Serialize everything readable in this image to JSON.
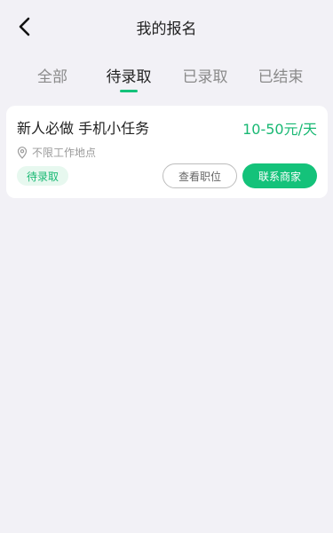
{
  "header": {
    "title": "我的报名",
    "back_icon": "back-arrow-icon"
  },
  "tabs": [
    {
      "label": "全部",
      "active": false
    },
    {
      "label": "待录取",
      "active": true
    },
    {
      "label": "已录取",
      "active": false
    },
    {
      "label": "已结束",
      "active": false
    }
  ],
  "colors": {
    "accent": "#14c27a",
    "salary": "#18b873",
    "background": "#f2f1f6"
  },
  "listings": [
    {
      "title": "新人必做 手机小任务",
      "salary": "10-50元/天",
      "location": "不限工作地点",
      "location_icon": "location-pin-icon",
      "status": "待录取",
      "view_button": "查看职位",
      "contact_button": "联系商家"
    }
  ]
}
